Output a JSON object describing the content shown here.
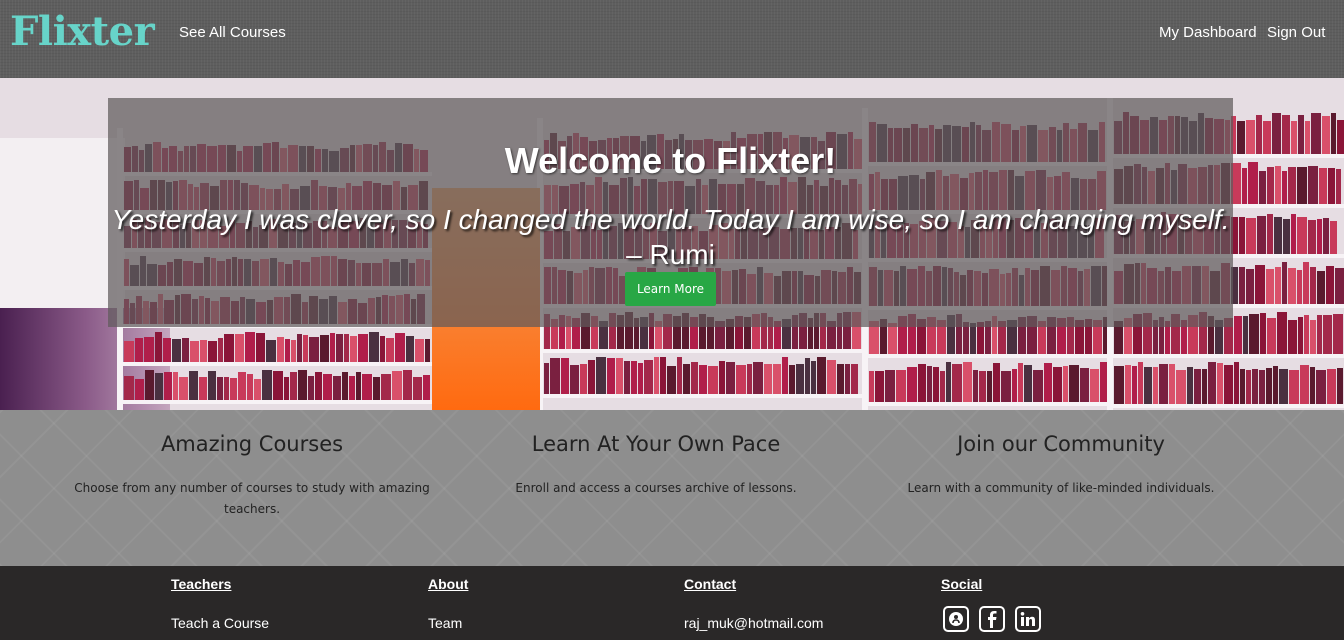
{
  "nav": {
    "brand": "Flixter",
    "see_all": "See All Courses",
    "dashboard": "My Dashboard",
    "signout": "Sign Out"
  },
  "hero": {
    "title": "Welcome to Flixter!",
    "quote": "Yesterday I was clever, so I changed the world. Today I am wise, so I am changing myself.",
    "author": " – Rumi",
    "button": "Learn More"
  },
  "features": [
    {
      "title": "Amazing Courses",
      "text": "Choose from any number of courses to study with amazing teachers."
    },
    {
      "title": "Learn At Your Own Pace",
      "text": "Enroll and access a courses archive of lessons."
    },
    {
      "title": "Join our Community",
      "text": "Learn with a community of like-minded individuals."
    }
  ],
  "footer": {
    "teachers": {
      "heading": "Teachers",
      "items": [
        "Teach a Course"
      ]
    },
    "about": {
      "heading": "About",
      "items": [
        "Team"
      ]
    },
    "contact": {
      "heading": "Contact",
      "items": [
        "raj_muk@hotmail.com"
      ]
    },
    "social": {
      "heading": "Social",
      "icons": [
        "github-icon",
        "facebook-icon",
        "linkedin-icon"
      ]
    }
  },
  "colors": {
    "brand": "#67d4c9",
    "button": "#28a745",
    "footer_bg": "#2a2828"
  }
}
